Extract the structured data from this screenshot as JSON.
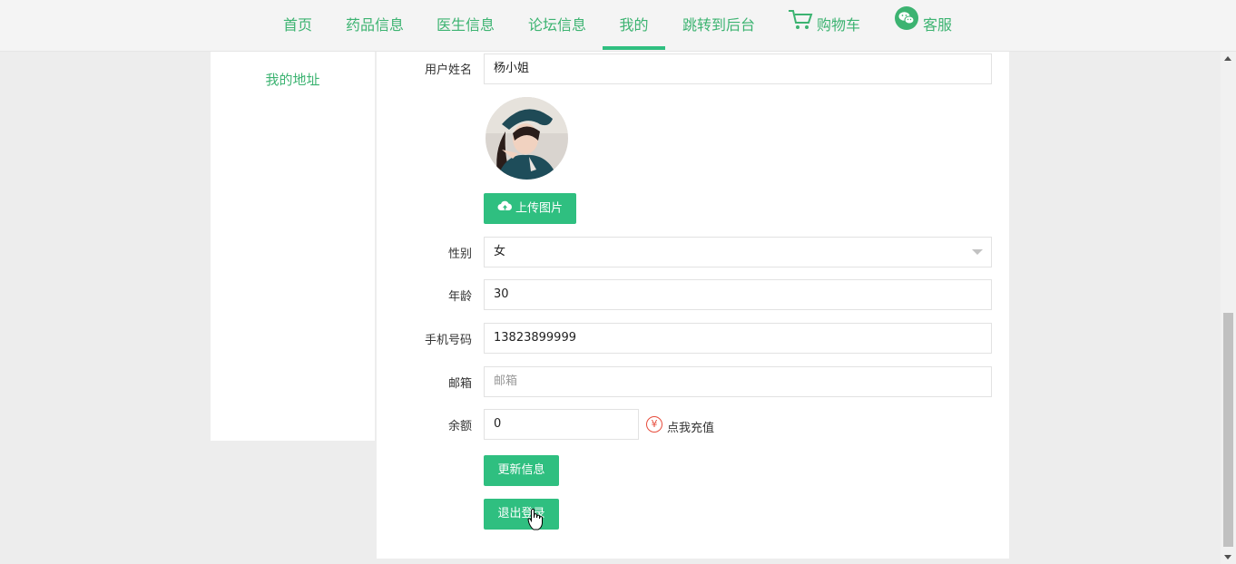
{
  "nav": {
    "items": [
      "首页",
      "药品信息",
      "医生信息",
      "论坛信息",
      "我的",
      "跳转到后台"
    ],
    "cart_label": "购物车",
    "service_label": "客服",
    "active_index": 4
  },
  "sidebar": {
    "address_link": "我的地址"
  },
  "form": {
    "username": {
      "label": "用户姓名",
      "value": "杨小姐"
    },
    "upload_button": "上传图片",
    "gender": {
      "label": "性别",
      "value": "女"
    },
    "age": {
      "label": "年龄",
      "value": "30"
    },
    "phone": {
      "label": "手机号码",
      "value": "13823899999"
    },
    "email": {
      "label": "邮箱",
      "placeholder": "邮箱"
    },
    "balance": {
      "label": "余额",
      "value": "0",
      "recharge_symbol": "¥",
      "recharge_label": "点我充值"
    },
    "update_button": "更新信息",
    "logout_button": "退出登录"
  },
  "colors": {
    "accent": "#2fbf80",
    "nav_text": "#3cb371",
    "recharge": "#e74c3c"
  },
  "icons": [
    "cart-icon",
    "wechat-icon",
    "cloud-upload-icon",
    "yuan-icon",
    "chevron-down-icon",
    "hand-cursor-icon"
  ]
}
